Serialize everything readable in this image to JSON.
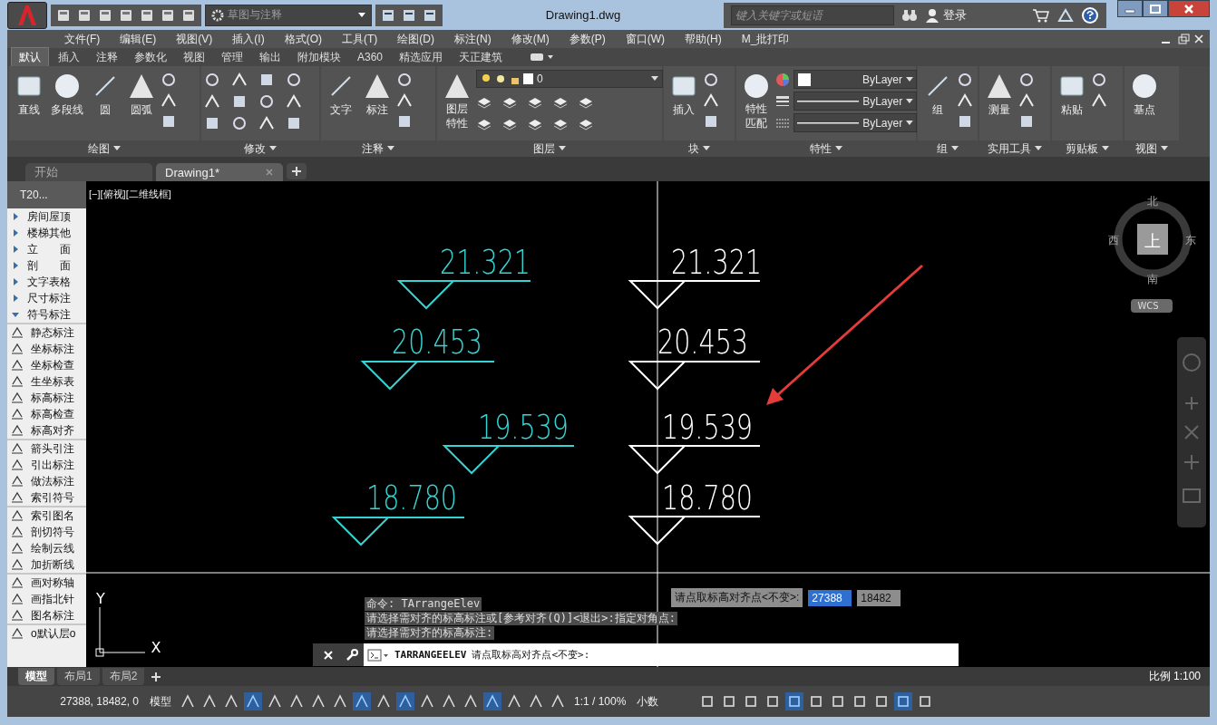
{
  "title_bar": {
    "workspace": "草图与注释",
    "title": "Drawing1.dwg",
    "search": {
      "placeholder": "键入关键字或短语"
    },
    "login": "登录"
  },
  "menu_bar": [
    "文件(F)",
    "编辑(E)",
    "视图(V)",
    "插入(I)",
    "格式(O)",
    "工具(T)",
    "绘图(D)",
    "标注(N)",
    "修改(M)",
    "参数(P)",
    "窗口(W)",
    "帮助(H)",
    "M_批打印"
  ],
  "ribbon_tabs": [
    {
      "label": "默认",
      "selected": true
    },
    {
      "label": "插入",
      "selected": false
    },
    {
      "label": "注释",
      "selected": false
    },
    {
      "label": "参数化",
      "selected": false
    },
    {
      "label": "视图",
      "selected": false
    },
    {
      "label": "管理",
      "selected": false
    },
    {
      "label": "输出",
      "selected": false
    },
    {
      "label": "附加模块",
      "selected": false
    },
    {
      "label": "A360",
      "selected": false
    },
    {
      "label": "精选应用",
      "selected": false
    },
    {
      "label": "天正建筑",
      "selected": false
    }
  ],
  "ribbon_panels": [
    {
      "title": "绘图",
      "tools": [
        "直线",
        "多段线",
        "圆",
        "圆弧"
      ]
    },
    {
      "title": "修改"
    },
    {
      "title": "注释",
      "tools": [
        "文字",
        "标注"
      ]
    },
    {
      "title": "图层",
      "tools": [
        "图层特性"
      ],
      "layer": "0"
    },
    {
      "title": "块",
      "tools": [
        "插入"
      ]
    },
    {
      "title": "特性",
      "tools": [
        "特性匹配"
      ],
      "properties": [
        "ByLayer",
        "ByLayer",
        "ByLayer"
      ]
    },
    {
      "title": "组",
      "tools": [
        "组"
      ]
    },
    {
      "title": "实用工具",
      "tools": [
        "测量"
      ]
    },
    {
      "title": "剪贴板",
      "tools": [
        "粘贴"
      ]
    },
    {
      "title": "视图",
      "tools": [
        "基点"
      ]
    }
  ],
  "doc_tabs": [
    {
      "label": "开始",
      "selected": false
    },
    {
      "label": "Drawing1*",
      "selected": true
    }
  ],
  "palette": {
    "title": "T20...",
    "folders": [
      {
        "label": "房间屋顶",
        "expanded": false
      },
      {
        "label": "楼梯其他",
        "expanded": false
      },
      {
        "label": "立　　面",
        "expanded": false
      },
      {
        "label": "剖　　面",
        "expanded": false
      },
      {
        "label": "文字表格",
        "expanded": false
      },
      {
        "label": "尺寸标注",
        "expanded": false
      },
      {
        "label": "符号标注",
        "expanded": true
      }
    ],
    "command_groups": [
      [
        "静态标注",
        "坐标标注",
        "坐标检查",
        "生坐标表",
        "标高标注",
        "标高检查",
        "标高对齐"
      ],
      [
        "箭头引注",
        "引出标注",
        "做法标注",
        "索引符号"
      ],
      [
        "索引图名",
        "剖切符号",
        "绘制云线",
        "加折断线"
      ],
      [
        "画对称轴",
        "画指北针",
        "图名标注"
      ],
      [
        "o默认层o"
      ]
    ]
  },
  "viewport": {
    "label": "[−][俯视][二维线框]",
    "marks": [
      {
        "value": "21.321",
        "color": "#35d4d4"
      },
      {
        "value": "20.453",
        "color": "#35d4d4"
      },
      {
        "value": "19.539",
        "color": "#35d4d4"
      },
      {
        "value": "18.780",
        "color": "#35d4d4"
      },
      {
        "value": "21.321",
        "color": "#ffffff"
      },
      {
        "value": "20.453",
        "color": "#ffffff"
      },
      {
        "value": "19.539",
        "color": "#ffffff"
      },
      {
        "value": "18.780",
        "color": "#ffffff"
      }
    ],
    "compass": {
      "north": "北",
      "south": "南",
      "east": "东",
      "west": "西",
      "top": "上",
      "ucs": "WCS"
    },
    "ucs_axes": {
      "y": "Y",
      "x": "X"
    },
    "command_history": [
      "命令: TArrangeElev",
      "请选择需对齐的标高标注或[参考对齐(Q)]<退出>:指定对角点:",
      "请选择需对齐的标高标注:"
    ],
    "command_line": {
      "command": "TARRANGEELEV",
      "prompt": "请点取标高对齐点<不变>:"
    },
    "dynamic_input": {
      "prompt": "请点取标高对齐点<不变>:",
      "fields": [
        {
          "value": "27388",
          "selected": true
        },
        {
          "value": "18482",
          "selected": false
        }
      ]
    }
  },
  "layout_tabs": [
    {
      "label": "模型",
      "selected": true
    },
    {
      "label": "布局1",
      "selected": false
    },
    {
      "label": "布局2",
      "selected": false
    }
  ],
  "scale": "比例 1:100",
  "status_bar": {
    "coordinates": "27388, 18482, 0",
    "space": "模型",
    "annotation_scale": "1:1 / 100%",
    "units": "小数",
    "toggles": [
      {
        "on": false
      },
      {
        "on": false
      },
      {
        "on": false
      },
      {
        "on": true
      },
      {
        "on": false
      },
      {
        "on": false
      },
      {
        "on": false
      },
      {
        "on": false
      },
      {
        "on": true
      },
      {
        "on": false
      },
      {
        "on": true
      },
      {
        "on": false
      },
      {
        "on": false
      },
      {
        "on": false
      },
      {
        "on": true
      },
      {
        "on": false
      },
      {
        "on": false
      },
      {
        "on": false
      }
    ],
    "toggles_right": [
      {
        "on": false
      },
      {
        "on": false
      },
      {
        "on": false
      },
      {
        "on": false
      },
      {
        "on": true
      },
      {
        "on": false
      },
      {
        "on": false
      },
      {
        "on": false
      },
      {
        "on": false
      },
      {
        "on": true
      },
      {
        "on": false
      }
    ]
  }
}
